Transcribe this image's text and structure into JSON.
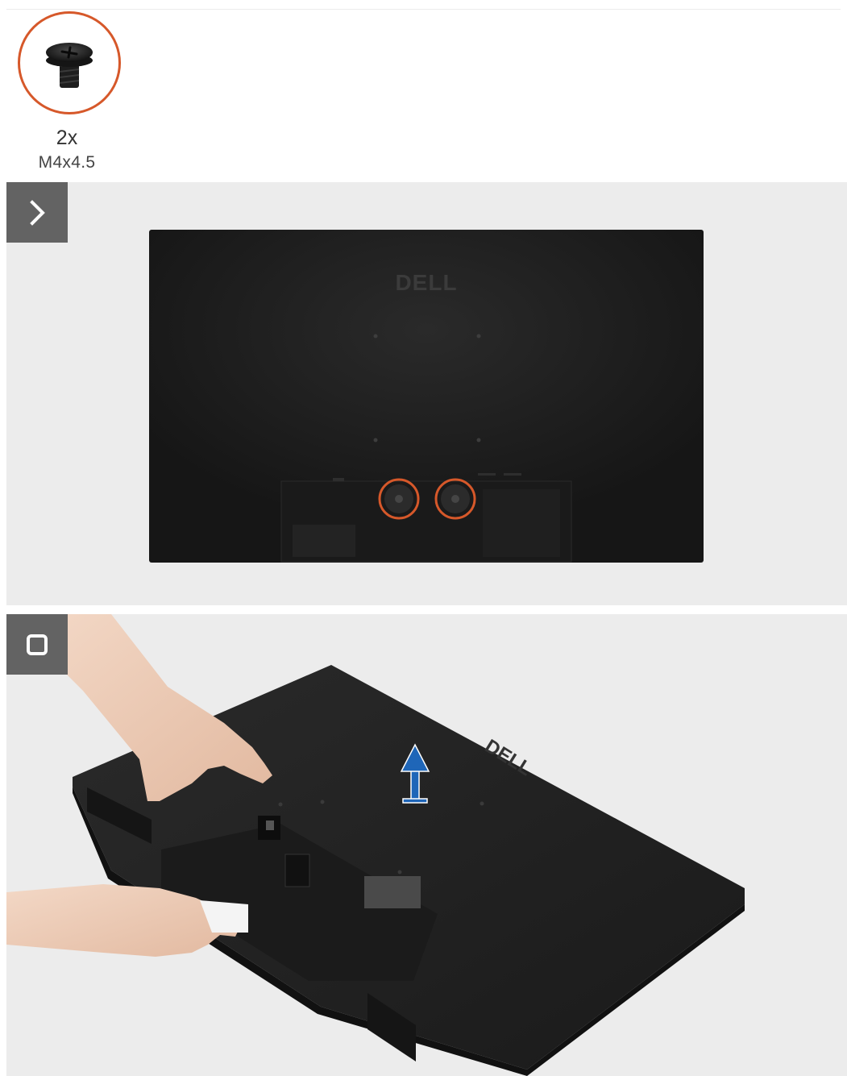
{
  "screw": {
    "quantity": "2x",
    "size": "M4x4.5",
    "ring_color": "#d6582a"
  },
  "steps": [
    {
      "icon": "chevron-right-icon",
      "brand_logo": "DELL"
    },
    {
      "icon": "stop-square-icon",
      "brand_logo": "DELL"
    }
  ],
  "colors": {
    "panel_bg": "#ececec",
    "badge_bg": "#636363",
    "monitor": "#1e1e1e",
    "accent_ring": "#d6582a",
    "arrow": "#1f66b8"
  }
}
